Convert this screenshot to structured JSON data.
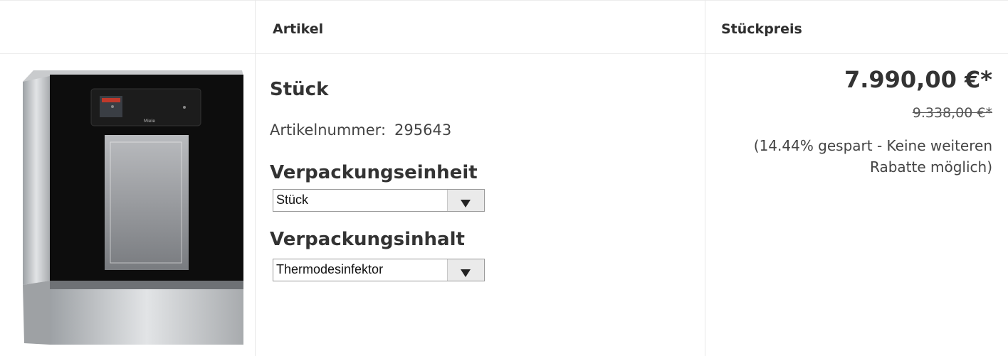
{
  "table": {
    "header": {
      "col_article": "Artikel",
      "col_unit_price": "Stückpreis"
    }
  },
  "product": {
    "title": "Stück",
    "article_number_label": "Artikelnummer:",
    "article_number": "295643",
    "image_icon": "dishwasher-image",
    "image_logo_text": "Miele",
    "pack_unit_heading": "Verpackungseinheit",
    "pack_unit_select": "Stück",
    "pack_content_heading": "Verpackungsinhalt",
    "pack_content_select": "Thermodesinfektor"
  },
  "pricing": {
    "price": "7.990,00 €*",
    "old_price": "9.338,00 €*",
    "savings_note": "(14.44% gespart - Keine weiteren Rabatte möglich)"
  }
}
